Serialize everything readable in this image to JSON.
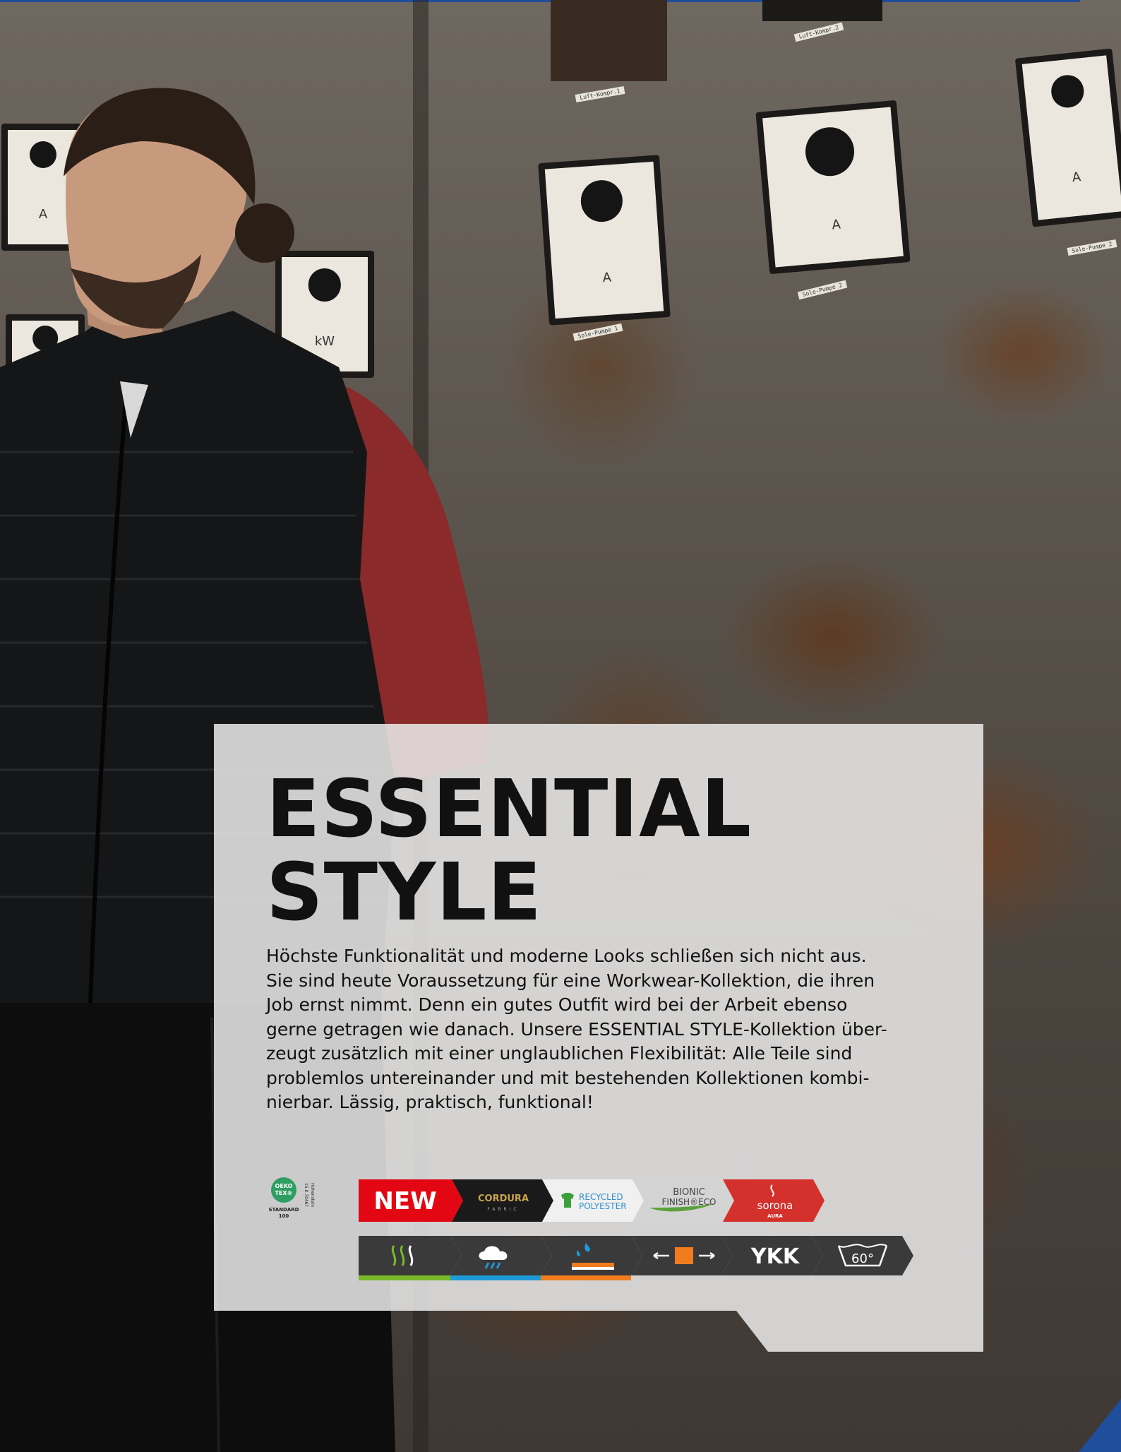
{
  "headline": {
    "line1": "ESSENTIAL",
    "line2": "STYLE"
  },
  "body_lines": [
    "Höchste Funktionalität und moderne Looks schließen sich nicht aus.",
    "Sie sind heute Voraussetzung für eine Workwear-Kollektion, die ihren",
    "Job ernst nimmt. Denn ein gutes Outfit wird bei der Arbeit ebenso",
    "gerne getragen wie danach. Unsere ESSENTIAL STYLE-Kollektion über-",
    "zeugt zusätzlich mit einer unglaublichen Flexibilität: Alle Teile sind",
    "problemlos untereinander und mit bestehenden Kollektionen kombi-",
    "nierbar. Lässig, praktisch, funktional!"
  ],
  "certificates": {
    "oeko_tex": {
      "line1": "OEKO",
      "line2": "TEX®",
      "standard": "STANDARD",
      "number": "100",
      "code": "15.0.7046?",
      "institute": "Hohenstein"
    },
    "new_label": "NEW",
    "cordura_label": "CORDURA",
    "cordura_sub": "FABRIC",
    "recycled_line1": "RECYCLED",
    "recycled_line2": "POLYESTER",
    "bionic_line1": "BIONIC",
    "bionic_line2": "FINISH®ECO",
    "sorona_label": "sorona",
    "sorona_sub": "AURA",
    "ykk_label": "YKK",
    "wash_label": "60°"
  },
  "scene_labels": {
    "gauge_unit_a": "A",
    "gauge_unit_kw": "kW",
    "tag_luft1": "Luft-Kompr.1",
    "tag_luft2": "Luft-Kompr.2",
    "tag_sole1": "Sole-Pumpe 1",
    "tag_sole2": "Sole-Pumpe 2"
  },
  "colors": {
    "accent_blue": "#1f4e9c",
    "new_red": "#e30613",
    "sorona_red": "#d5312c",
    "oeko_green": "#2f9e62",
    "icon_dark": "#3a3a3a",
    "stripe_green": "#7ab929",
    "stripe_blue": "#1e9ad6",
    "stripe_orange": "#f07c1e"
  },
  "icons": [
    "oeko-tex-logo",
    "cordura-logo",
    "recycled-shirt-icon",
    "bionic-finish-logo",
    "sorona-logo",
    "breathable-icon",
    "windproof-rain-icon",
    "waterproof-icon",
    "stretch-icon",
    "ykk-logo",
    "wash-60-icon"
  ]
}
